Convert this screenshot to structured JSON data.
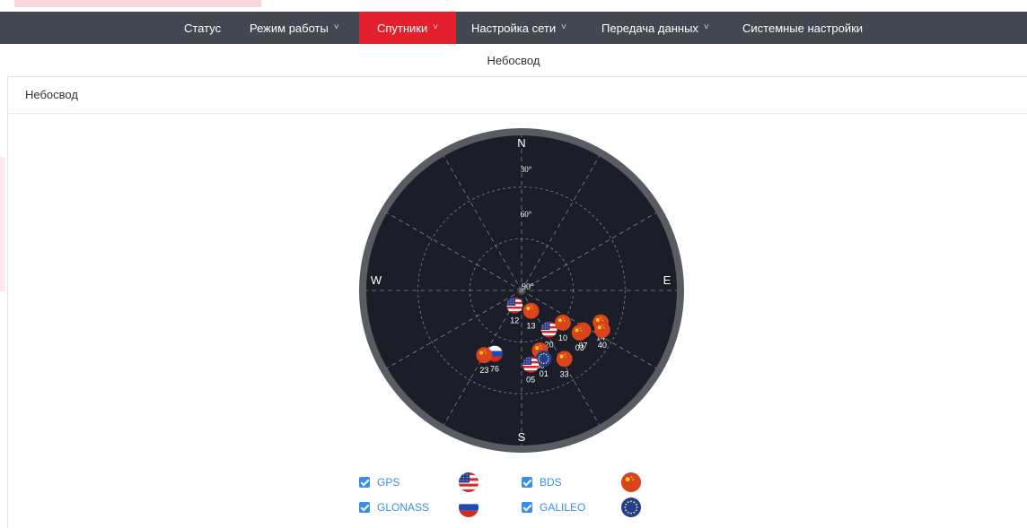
{
  "nav": {
    "items": [
      {
        "label": "Статус",
        "has_dropdown": false,
        "active": false
      },
      {
        "label": "Режим работы",
        "has_dropdown": true,
        "active": false
      },
      {
        "label": "Спутники",
        "has_dropdown": true,
        "active": true
      },
      {
        "label": "Настройка сети",
        "has_dropdown": true,
        "active": false
      },
      {
        "label": "Передача данных",
        "has_dropdown": true,
        "active": false
      },
      {
        "label": "Системные настройки",
        "has_dropdown": false,
        "active": false
      }
    ],
    "chevron": "˅",
    "background": "#43474f",
    "active_color": "#e5202e"
  },
  "subtab": {
    "label": "Небосвод"
  },
  "panel": {
    "title": "Небосвод"
  },
  "skyplot": {
    "directions": {
      "north": "N",
      "south": "S",
      "east": "E",
      "west": "W"
    },
    "elevation_labels": [
      "30°",
      "60°",
      "90°"
    ],
    "satellites": [
      {
        "id": "12",
        "constellation": "GPS",
        "azimuth": 205,
        "elevation": 79
      },
      {
        "id": "13",
        "constellation": "BDS",
        "azimuth": 155,
        "elevation": 75
      },
      {
        "id": "20",
        "constellation": "GPS",
        "azimuth": 145,
        "elevation": 58
      },
      {
        "id": "10",
        "constellation": "BDS",
        "azimuth": 128,
        "elevation": 55
      },
      {
        "id": "14",
        "constellation": "BDS",
        "azimuth": 112,
        "elevation": 33
      },
      {
        "id": "40",
        "constellation": "BDS",
        "azimuth": 116,
        "elevation": 30
      },
      {
        "id": "07",
        "constellation": "BDS",
        "azimuth": 123,
        "elevation": 41
      },
      {
        "id": "03",
        "constellation": "BDS",
        "azimuth": 126,
        "elevation": 42
      },
      {
        "id": "60",
        "constellation": "BDS",
        "azimuth": 163,
        "elevation": 48
      },
      {
        "id": "01",
        "constellation": "GALILEO",
        "azimuth": 162,
        "elevation": 42
      },
      {
        "id": "05",
        "constellation": "GPS",
        "azimuth": 173,
        "elevation": 40
      },
      {
        "id": "33",
        "constellation": "BDS",
        "azimuth": 148,
        "elevation": 36
      },
      {
        "id": "76",
        "constellation": "GLONASS",
        "azimuth": 203,
        "elevation": 44
      },
      {
        "id": "23",
        "constellation": "BDS",
        "azimuth": 210,
        "elevation": 40
      }
    ]
  },
  "legend": [
    {
      "label": "GPS",
      "constellation": "GPS",
      "checked": true
    },
    {
      "label": "BDS",
      "constellation": "BDS",
      "checked": true
    },
    {
      "label": "GLONASS",
      "constellation": "GLONASS",
      "checked": true
    },
    {
      "label": "GALILEO",
      "constellation": "GALILEO",
      "checked": true
    }
  ],
  "colors": {
    "sky_background": "#1b1e27",
    "sky_ring": "#5a5c63",
    "checkbox": "#3a8ee6"
  }
}
